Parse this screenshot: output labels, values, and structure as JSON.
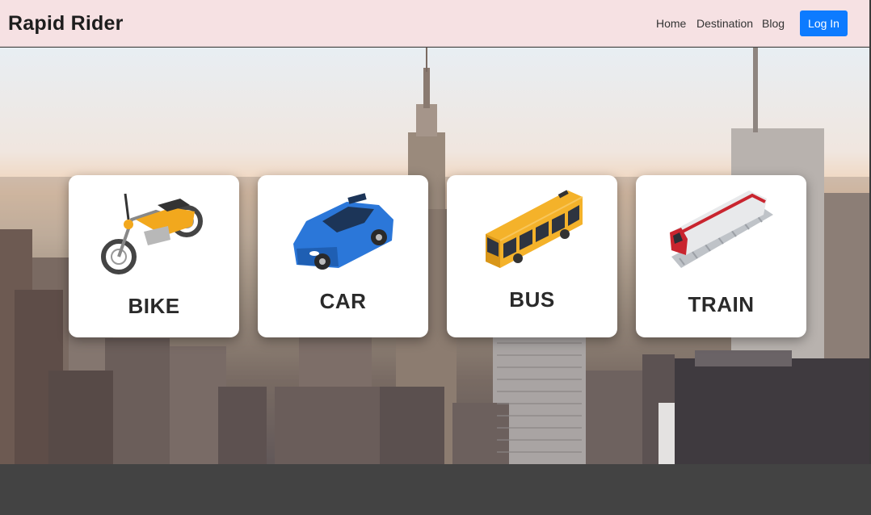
{
  "navbar": {
    "brand": "Rapid Rider",
    "links": [
      "Home",
      "Destination",
      "Blog"
    ],
    "login_label": "Log In"
  },
  "cards": [
    {
      "label": "BIKE",
      "icon": "motorcycle-icon"
    },
    {
      "label": "CAR",
      "icon": "car-icon"
    },
    {
      "label": "BUS",
      "icon": "bus-icon"
    },
    {
      "label": "TRAIN",
      "icon": "train-icon"
    }
  ],
  "colors": {
    "navbar_bg": "#f6e1e3",
    "login_button": "#0d7bff",
    "card_bg": "#ffffff",
    "footer_band": "#434343"
  }
}
